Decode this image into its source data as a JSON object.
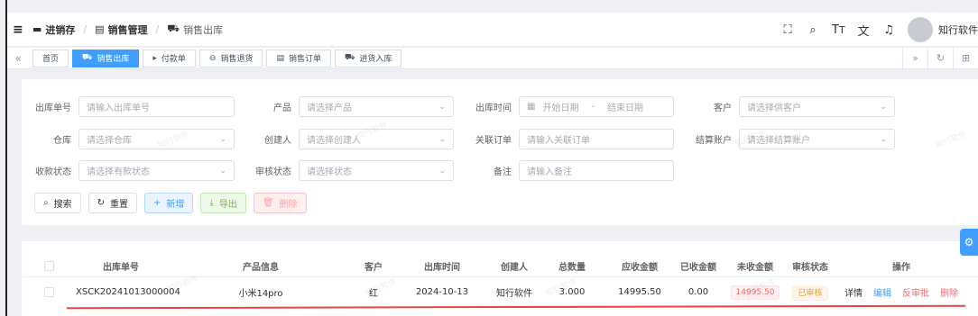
{
  "header": {
    "breadcrumb": [
      {
        "label": "进销存",
        "icon": "storage-icon"
      },
      {
        "label": "销售管理",
        "icon": "document-icon"
      },
      {
        "label": "销售出库",
        "icon": "truck-icon"
      }
    ],
    "icons": [
      "fullscreen-icon",
      "search-icon",
      "font-size-icon",
      "translate-icon",
      "bell-icon"
    ],
    "username": "知行软件"
  },
  "tabs": [
    {
      "label": "首页",
      "icon": ""
    },
    {
      "label": "销售出库",
      "icon": "truck-icon",
      "active": true
    },
    {
      "label": "付款单",
      "icon": "caret-right-icon"
    },
    {
      "label": "销售退货",
      "icon": "minus-circle-icon"
    },
    {
      "label": "销售订单",
      "icon": "document-icon"
    },
    {
      "label": "进货入库",
      "icon": "truck-icon"
    }
  ],
  "form": {
    "out_no": {
      "label": "出库单号",
      "placeholder": "请输入出库单号"
    },
    "product": {
      "label": "产品",
      "placeholder": "请选择产品"
    },
    "out_time": {
      "label": "出库时间",
      "start": "开始日期",
      "sep": "-",
      "end": "结束日期"
    },
    "customer": {
      "label": "客户",
      "placeholder": "请选择供客户"
    },
    "warehouse": {
      "label": "仓库",
      "placeholder": "请选择仓库"
    },
    "creator": {
      "label": "创建人",
      "placeholder": "请选择创建人"
    },
    "related_order": {
      "label": "关联订单",
      "placeholder": "请输入关联订单"
    },
    "account": {
      "label": "结算账户",
      "placeholder": "请选择结算账户"
    },
    "collect_status": {
      "label": "收款状态",
      "placeholder": "请选择有款状态"
    },
    "audit_status": {
      "label": "审核状态",
      "placeholder": "请选择状态"
    },
    "remark": {
      "label": "备注",
      "placeholder": "请输入备注"
    }
  },
  "buttons": {
    "search": "搜索",
    "reset": "重置",
    "add": "新增",
    "export": "导出",
    "delete": "删除"
  },
  "table": {
    "columns": [
      "出库单号",
      "产品信息",
      "客户",
      "出库时间",
      "创建人",
      "总数量",
      "应收金额",
      "已收金额",
      "未收金额",
      "审核状态",
      "操作"
    ],
    "rows": [
      {
        "out_no": "XSCK20241013000004",
        "product": "小米14pro",
        "customer": "红",
        "out_time": "2024-10-13",
        "creator": "知行软件",
        "qty": "3.000",
        "receivable": "14995.50",
        "received": "0.00",
        "unreceived": "14995.50",
        "audit": "已审核",
        "ops": {
          "detail": "详情",
          "edit": "编辑",
          "unaudit": "反审批",
          "delete": "删除"
        }
      }
    ]
  },
  "watermark": "知行软件"
}
